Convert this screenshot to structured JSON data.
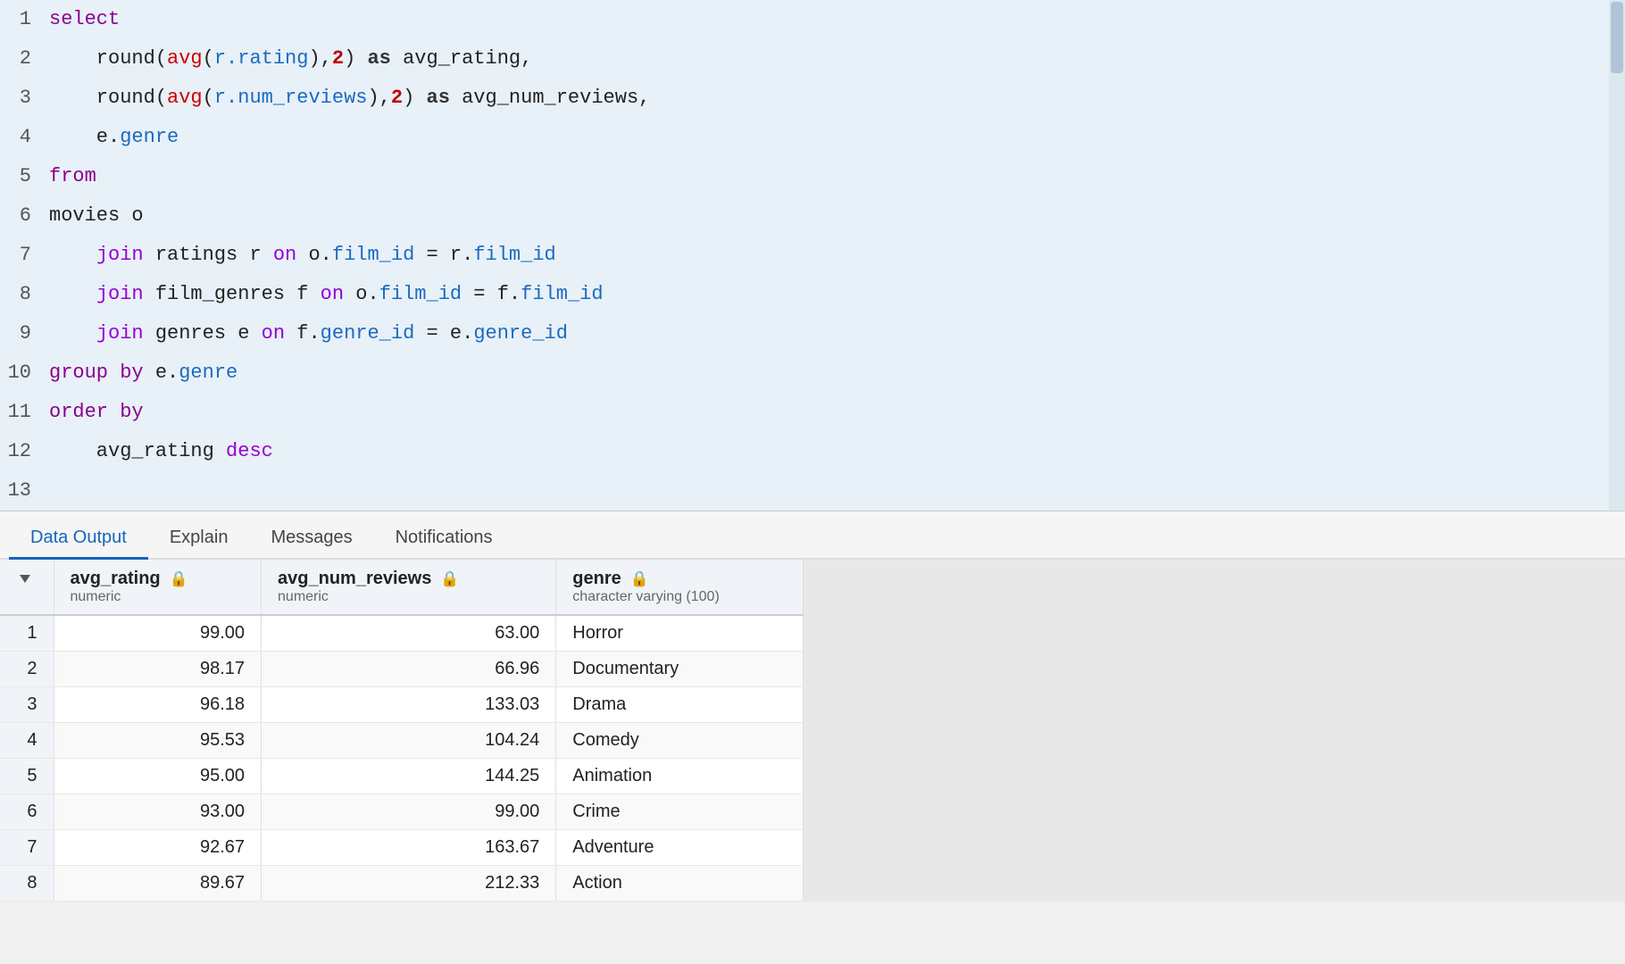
{
  "editor": {
    "lines": [
      {
        "num": 1,
        "tokens": [
          {
            "text": "select",
            "cls": "kw-blue"
          }
        ]
      },
      {
        "num": 2,
        "tokens": [
          {
            "text": "    round(",
            "cls": "plain"
          },
          {
            "text": "avg",
            "cls": "kw-func"
          },
          {
            "text": "(",
            "cls": "plain"
          },
          {
            "text": "r.rating",
            "cls": "col-blue"
          },
          {
            "text": "),",
            "cls": "plain"
          },
          {
            "text": "2",
            "cls": "num"
          },
          {
            "text": ") ",
            "cls": "plain"
          },
          {
            "text": "as",
            "cls": "kw-as"
          },
          {
            "text": " avg_rating,",
            "cls": "plain"
          }
        ]
      },
      {
        "num": 3,
        "tokens": [
          {
            "text": "    round(",
            "cls": "plain"
          },
          {
            "text": "avg",
            "cls": "kw-func"
          },
          {
            "text": "(",
            "cls": "plain"
          },
          {
            "text": "r.num_reviews",
            "cls": "col-blue"
          },
          {
            "text": "),",
            "cls": "plain"
          },
          {
            "text": "2",
            "cls": "num"
          },
          {
            "text": ") ",
            "cls": "plain"
          },
          {
            "text": "as",
            "cls": "kw-as"
          },
          {
            "text": " avg_num_reviews,",
            "cls": "plain"
          }
        ]
      },
      {
        "num": 4,
        "tokens": [
          {
            "text": "    e.",
            "cls": "plain"
          },
          {
            "text": "genre",
            "cls": "col-blue"
          }
        ]
      },
      {
        "num": 5,
        "tokens": [
          {
            "text": "from",
            "cls": "kw-blue"
          }
        ]
      },
      {
        "num": 6,
        "tokens": [
          {
            "text": "movies o",
            "cls": "plain"
          }
        ]
      },
      {
        "num": 7,
        "tokens": [
          {
            "text": "    ",
            "cls": "plain"
          },
          {
            "text": "join",
            "cls": "kw-purple"
          },
          {
            "text": " ratings r ",
            "cls": "plain"
          },
          {
            "text": "on",
            "cls": "kw-purple"
          },
          {
            "text": " o.",
            "cls": "plain"
          },
          {
            "text": "film_id",
            "cls": "col-blue"
          },
          {
            "text": " = r.",
            "cls": "plain"
          },
          {
            "text": "film_id",
            "cls": "col-blue"
          }
        ]
      },
      {
        "num": 8,
        "tokens": [
          {
            "text": "    ",
            "cls": "plain"
          },
          {
            "text": "join",
            "cls": "kw-purple"
          },
          {
            "text": " film_genres f ",
            "cls": "plain"
          },
          {
            "text": "on",
            "cls": "kw-purple"
          },
          {
            "text": " o.",
            "cls": "plain"
          },
          {
            "text": "film_id",
            "cls": "col-blue"
          },
          {
            "text": " = f.",
            "cls": "plain"
          },
          {
            "text": "film_id",
            "cls": "col-blue"
          }
        ]
      },
      {
        "num": 9,
        "tokens": [
          {
            "text": "    ",
            "cls": "plain"
          },
          {
            "text": "join",
            "cls": "kw-purple"
          },
          {
            "text": " genres e ",
            "cls": "plain"
          },
          {
            "text": "on",
            "cls": "kw-purple"
          },
          {
            "text": " f.",
            "cls": "plain"
          },
          {
            "text": "genre_id",
            "cls": "col-blue"
          },
          {
            "text": " = e.",
            "cls": "plain"
          },
          {
            "text": "genre_id",
            "cls": "col-blue"
          }
        ]
      },
      {
        "num": 10,
        "tokens": [
          {
            "text": "group",
            "cls": "kw-blue"
          },
          {
            "text": " ",
            "cls": "plain"
          },
          {
            "text": "by",
            "cls": "kw-blue"
          },
          {
            "text": " e.",
            "cls": "plain"
          },
          {
            "text": "genre",
            "cls": "col-blue"
          }
        ]
      },
      {
        "num": 11,
        "tokens": [
          {
            "text": "order",
            "cls": "kw-blue"
          },
          {
            "text": " ",
            "cls": "plain"
          },
          {
            "text": "by",
            "cls": "kw-blue"
          }
        ]
      },
      {
        "num": 12,
        "tokens": [
          {
            "text": "    avg_rating ",
            "cls": "plain"
          },
          {
            "text": "desc",
            "cls": "kw-purple"
          }
        ]
      },
      {
        "num": 13,
        "tokens": [
          {
            "text": "",
            "cls": "plain"
          }
        ]
      }
    ]
  },
  "tabs": {
    "items": [
      {
        "label": "Data Output",
        "active": true
      },
      {
        "label": "Explain",
        "active": false
      },
      {
        "label": "Messages",
        "active": false
      },
      {
        "label": "Notifications",
        "active": false
      }
    ]
  },
  "table": {
    "columns": [
      {
        "name": "avg_rating",
        "type": "numeric",
        "has_lock": true
      },
      {
        "name": "avg_num_reviews",
        "type": "numeric",
        "has_lock": true
      },
      {
        "name": "genre",
        "type": "character varying (100)",
        "has_lock": true
      }
    ],
    "rows": [
      {
        "row_num": 1,
        "avg_rating": "99.00",
        "avg_num_reviews": "63.00",
        "genre": "Horror"
      },
      {
        "row_num": 2,
        "avg_rating": "98.17",
        "avg_num_reviews": "66.96",
        "genre": "Documentary"
      },
      {
        "row_num": 3,
        "avg_rating": "96.18",
        "avg_num_reviews": "133.03",
        "genre": "Drama"
      },
      {
        "row_num": 4,
        "avg_rating": "95.53",
        "avg_num_reviews": "104.24",
        "genre": "Comedy"
      },
      {
        "row_num": 5,
        "avg_rating": "95.00",
        "avg_num_reviews": "144.25",
        "genre": "Animation"
      },
      {
        "row_num": 6,
        "avg_rating": "93.00",
        "avg_num_reviews": "99.00",
        "genre": "Crime"
      },
      {
        "row_num": 7,
        "avg_rating": "92.67",
        "avg_num_reviews": "163.67",
        "genre": "Adventure"
      },
      {
        "row_num": 8,
        "avg_rating": "89.67",
        "avg_num_reviews": "212.33",
        "genre": "Action"
      }
    ]
  }
}
